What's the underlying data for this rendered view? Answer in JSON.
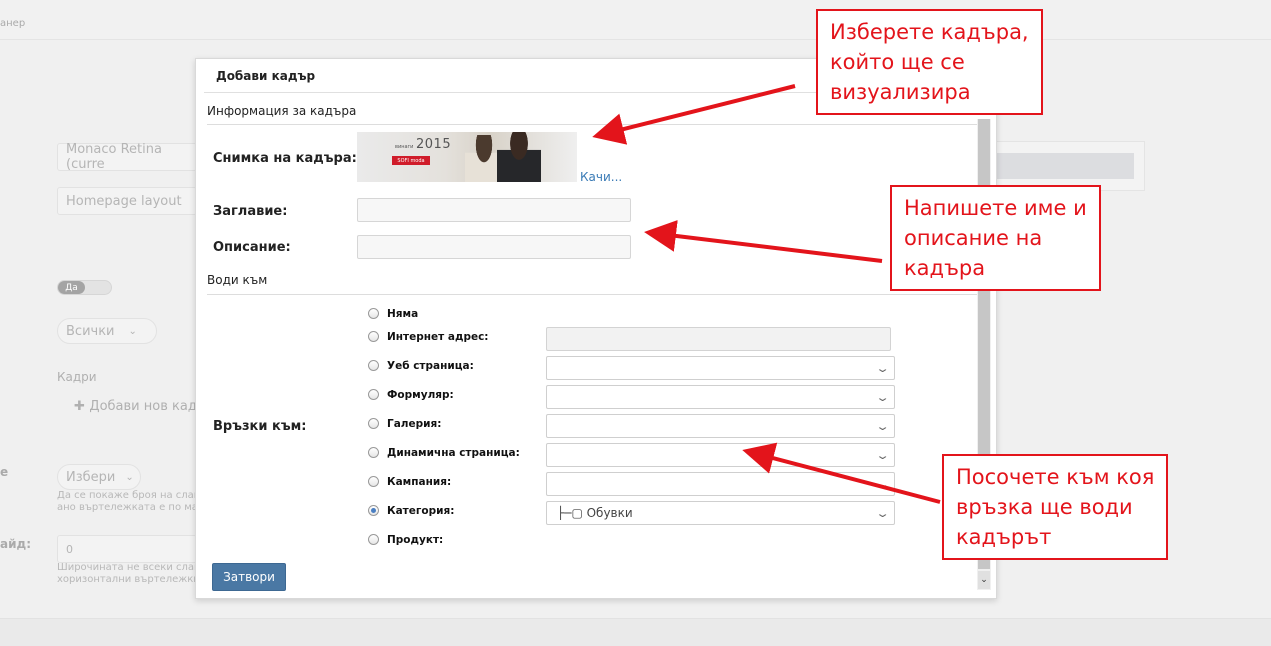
{
  "background": {
    "breadcrumb": "анер",
    "theme_field": "Monaco Retina (curre",
    "layout_field": "Homepage layout",
    "toggle_label": "Да",
    "filter_select": "Всички",
    "frames_label": "Кадри",
    "add_frame_button": "Добави нов кадъ",
    "side_label_1": "е",
    "side_select": "Избери",
    "hint_1": "Да се покаже броя на слайд",
    "hint_2": "ано въртележката е по малк",
    "side_label_2": "айд:",
    "number_field": "0",
    "hint_3": "Широчината не всеки слайд",
    "hint_4": "хоризонтални въртележки!"
  },
  "modal": {
    "title": "Добави кадър",
    "section_info": "Информация за кадъра",
    "image_label": "Снимка на кадъра:",
    "image": {
      "year": "2015",
      "tagline": "винаги",
      "badge": "SOFI moda"
    },
    "upload_link": "Качи...",
    "title_label": "Заглавие:",
    "title_value": "",
    "description_label": "Описание:",
    "description_value": "",
    "section_links": "Води към",
    "links_label": "Връзки към:",
    "link_options": [
      {
        "label": "Няма",
        "checked": false
      },
      {
        "label": "Интернет адрес:",
        "checked": false
      },
      {
        "label": "Уеб страница:",
        "checked": false
      },
      {
        "label": "Формуляр:",
        "checked": false
      },
      {
        "label": "Галерия:",
        "checked": false
      },
      {
        "label": "Динамична страница:",
        "checked": false
      },
      {
        "label": "Кампания:",
        "checked": false
      },
      {
        "label": "Категория:",
        "checked": true
      },
      {
        "label": "Продукт:",
        "checked": false
      }
    ],
    "category_value": "├─▢ Обувки",
    "close_button": "Затвори"
  },
  "callouts": {
    "select_frame": [
      "Изберете кадъра,",
      "който ще се",
      "визуализира"
    ],
    "name_description": [
      "Напишете име и",
      "описание на",
      "кадъра"
    ],
    "link_target": [
      "Посочете към коя",
      "връзка ще води",
      "кадърът"
    ]
  },
  "colors": {
    "accent_red": "#e3141b",
    "button_blue": "#4a78a4",
    "link_blue": "#3a7bb6"
  }
}
